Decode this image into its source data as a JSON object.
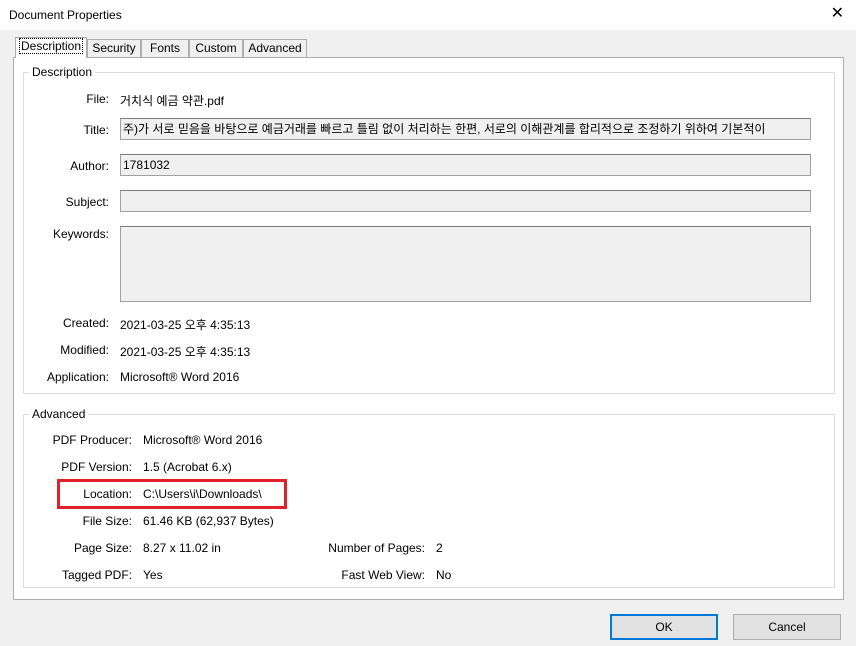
{
  "window": {
    "title": "Document Properties",
    "close_glyph": "✕"
  },
  "tabs": [
    {
      "label": "Description",
      "active": true
    },
    {
      "label": "Security"
    },
    {
      "label": "Fonts"
    },
    {
      "label": "Custom"
    },
    {
      "label": "Advanced"
    }
  ],
  "description": {
    "group_label": "Description",
    "file_label": "File:",
    "file_value": "거치식 예금 약관.pdf",
    "title_label": "Title:",
    "title_value": "주)가 서로 믿음을 바탕으로 예금거래를 빠르고 틀림 없이 처리하는 한편, 서로의 이해관계를 합리적으로 조정하기 위하여 기본적이",
    "author_label": "Author:",
    "author_value": "1781032",
    "subject_label": "Subject:",
    "subject_value": "",
    "keywords_label": "Keywords:",
    "keywords_value": "",
    "created_label": "Created:",
    "created_value": "2021-03-25 오후 4:35:13",
    "modified_label": "Modified:",
    "modified_value": "2021-03-25 오후 4:35:13",
    "application_label": "Application:",
    "application_value": "Microsoft® Word 2016"
  },
  "advanced": {
    "group_label": "Advanced",
    "producer_label": "PDF Producer:",
    "producer_value": "Microsoft® Word 2016",
    "version_label": "PDF Version:",
    "version_value": "1.5 (Acrobat 6.x)",
    "location_label": "Location:",
    "location_value": "C:\\Users\\i\\Downloads\\",
    "filesize_label": "File Size:",
    "filesize_value": "61.46 KB (62,937 Bytes)",
    "pagesize_label": "Page Size:",
    "pagesize_value": "8.27 x 11.02 in",
    "numpages_label": "Number of Pages:",
    "numpages_value": "2",
    "tagged_label": "Tagged PDF:",
    "tagged_value": "Yes",
    "fastweb_label": "Fast Web View:",
    "fastweb_value": "No"
  },
  "buttons": {
    "ok": "OK",
    "cancel": "Cancel"
  },
  "colors": {
    "highlight": "#e0202a",
    "default_button_border": "#0078d7"
  }
}
